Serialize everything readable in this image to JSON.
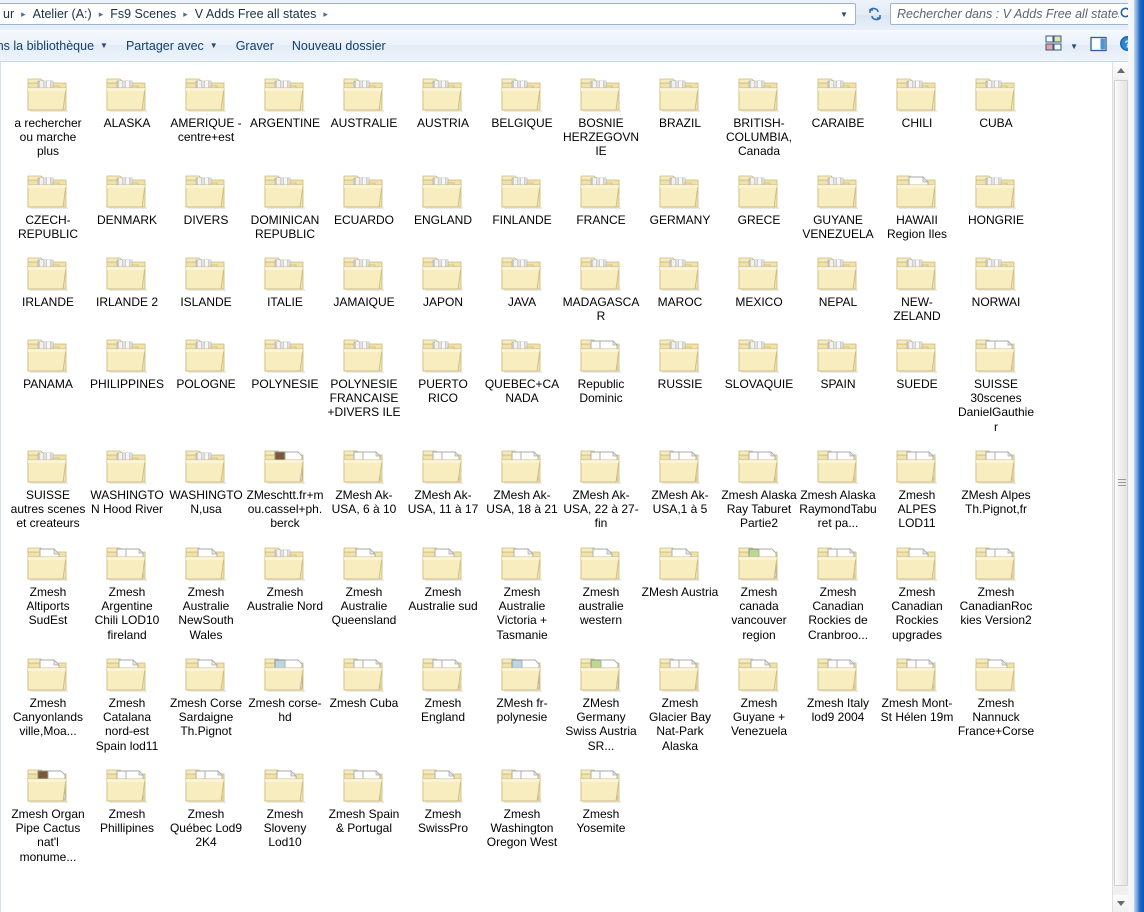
{
  "window": {
    "accent_color": "#1b69c6",
    "chrome_color": "#e3ebf6"
  },
  "addressbar": {
    "crumbs": [
      "ur",
      "Atelier (A:)",
      "Fs9 Scenes",
      "V Adds Free all states"
    ],
    "separator": "▸",
    "dropdown_icon": "chevron-down-icon",
    "refresh_icon": "refresh-icon",
    "search": {
      "placeholder": "Rechercher dans : V Adds Free all states",
      "value": "",
      "icon": "search-icon"
    }
  },
  "commandbar": {
    "items": [
      {
        "label": "lans la bibliothèque",
        "has_caret": true
      },
      {
        "label": "Partager avec",
        "has_caret": true
      },
      {
        "label": "Graver",
        "has_caret": false
      },
      {
        "label": "Nouveau dossier",
        "has_caret": false
      }
    ],
    "right_buttons": [
      {
        "name": "change-view-button",
        "icon": "view-icon"
      },
      {
        "name": "view-dropdown-button",
        "icon": "chevron-down-icon"
      },
      {
        "name": "preview-pane-button",
        "icon": "preview-pane-icon"
      },
      {
        "name": "help-button",
        "icon": "help-icon"
      }
    ]
  },
  "scrollbar": {
    "up_icon": "triangle-up-icon",
    "down_icon": "triangle-down-icon",
    "thumb_position_percent": 0
  },
  "files": {
    "columns": 13,
    "items": [
      {
        "name": "a rechercher ou marche plus",
        "icon": "folder-closed"
      },
      {
        "name": "ALASKA",
        "icon": "folder-closed"
      },
      {
        "name": "AMERIQUE -centre+est",
        "icon": "folder-closed"
      },
      {
        "name": "ARGENTINE",
        "icon": "folder-closed"
      },
      {
        "name": "AUSTRALIE",
        "icon": "folder-closed"
      },
      {
        "name": "AUSTRIA",
        "icon": "folder-closed"
      },
      {
        "name": "BELGIQUE",
        "icon": "folder-closed"
      },
      {
        "name": "BOSNIE HERZEGOVNIE",
        "icon": "folder-closed"
      },
      {
        "name": "BRAZIL",
        "icon": "folder-closed"
      },
      {
        "name": "BRITISH-COLUMBIA, Canada",
        "icon": "folder-closed"
      },
      {
        "name": "CARAIBE",
        "icon": "folder-closed"
      },
      {
        "name": "CHILI",
        "icon": "folder-closed"
      },
      {
        "name": "CUBA",
        "icon": "folder-closed"
      },
      {
        "name": "CZECH-REPUBLIC",
        "icon": "folder-closed"
      },
      {
        "name": "DENMARK",
        "icon": "folder-closed"
      },
      {
        "name": "DIVERS",
        "icon": "folder-closed"
      },
      {
        "name": "DOMINICAN REPUBLIC",
        "icon": "folder-closed"
      },
      {
        "name": "ECUARDO",
        "icon": "folder-closed"
      },
      {
        "name": "ENGLAND",
        "icon": "folder-closed"
      },
      {
        "name": "FINLANDE",
        "icon": "folder-closed"
      },
      {
        "name": "FRANCE",
        "icon": "folder-closed"
      },
      {
        "name": "GERMANY",
        "icon": "folder-closed"
      },
      {
        "name": "GRECE",
        "icon": "folder-closed"
      },
      {
        "name": "GUYANE VENEZUELA",
        "icon": "folder-closed"
      },
      {
        "name": "HAWAII Region Iles",
        "icon": "folder-one-doc"
      },
      {
        "name": "HONGRIE",
        "icon": "folder-closed"
      },
      {
        "name": "IRLANDE",
        "icon": "folder-closed"
      },
      {
        "name": "IRLANDE 2",
        "icon": "folder-closed"
      },
      {
        "name": "ISLANDE",
        "icon": "folder-closed"
      },
      {
        "name": "ITALIE",
        "icon": "folder-closed"
      },
      {
        "name": "JAMAIQUE",
        "icon": "folder-closed"
      },
      {
        "name": "JAPON",
        "icon": "folder-closed"
      },
      {
        "name": "JAVA",
        "icon": "folder-closed"
      },
      {
        "name": "MADAGASCAR",
        "icon": "folder-closed"
      },
      {
        "name": "MAROC",
        "icon": "folder-closed"
      },
      {
        "name": "MEXICO",
        "icon": "folder-closed"
      },
      {
        "name": "NEPAL",
        "icon": "folder-closed"
      },
      {
        "name": "NEW-ZELAND",
        "icon": "folder-closed"
      },
      {
        "name": "NORWAI",
        "icon": "folder-closed"
      },
      {
        "name": "PANAMA",
        "icon": "folder-closed"
      },
      {
        "name": "PHILIPPINES",
        "icon": "folder-closed"
      },
      {
        "name": "POLOGNE",
        "icon": "folder-closed"
      },
      {
        "name": "POLYNESIE",
        "icon": "folder-closed"
      },
      {
        "name": "POLYNESIE FRANCAISE +DIVERS ILE",
        "icon": "folder-closed"
      },
      {
        "name": "PUERTO RICO",
        "icon": "folder-closed"
      },
      {
        "name": "QUEBEC+CANADA",
        "icon": "folder-closed"
      },
      {
        "name": "Republic Dominic",
        "icon": "folder-two-docs"
      },
      {
        "name": "RUSSIE",
        "icon": "folder-closed"
      },
      {
        "name": "SLOVAQUIE",
        "icon": "folder-closed"
      },
      {
        "name": "SPAIN",
        "icon": "folder-closed"
      },
      {
        "name": "SUEDE",
        "icon": "folder-closed"
      },
      {
        "name": "SUISSE 30scenes DanielGauthier",
        "icon": "folder-two-docs"
      },
      {
        "name": "SUISSE autres scenes et createurs",
        "icon": "folder-closed"
      },
      {
        "name": "WASHINGTON Hood River",
        "icon": "folder-closed"
      },
      {
        "name": "WASHINGTON,usa",
        "icon": "folder-closed"
      },
      {
        "name": "ZMeschtt.fr+mou.cassel+ph.berck",
        "icon": "folder-thumb-dark"
      },
      {
        "name": "ZMesh Ak-USA, 6 à 10",
        "icon": "folder-two-docs"
      },
      {
        "name": "ZMesh Ak-USA, 11 à 17",
        "icon": "folder-two-docs"
      },
      {
        "name": "ZMesh Ak-USA, 18 à 21",
        "icon": "folder-two-docs"
      },
      {
        "name": "ZMesh Ak-USA, 22 à 27-fin",
        "icon": "folder-two-docs"
      },
      {
        "name": "ZMesh Ak-USA,1 à 5",
        "icon": "folder-two-docs"
      },
      {
        "name": "Zmesh Alaska Ray Taburet Partie2",
        "icon": "folder-two-docs"
      },
      {
        "name": "Zmesh Alaska RaymondTaburet pa...",
        "icon": "folder-two-docs"
      },
      {
        "name": "Zmesh ALPES LOD11",
        "icon": "folder-two-docs"
      },
      {
        "name": "ZMesh Alpes Th.Pignot,fr",
        "icon": "folder-two-docs"
      },
      {
        "name": "Zmesh Altiports SudEst",
        "icon": "folder-one-doc"
      },
      {
        "name": "Zmesh Argentine Chili LOD10 fireland",
        "icon": "folder-two-docs"
      },
      {
        "name": "Zmesh Australie NewSouth Wales",
        "icon": "folder-one-doc"
      },
      {
        "name": "Zmesh Australie Nord",
        "icon": "folder-closed"
      },
      {
        "name": "Zmesh Australie Queensland",
        "icon": "folder-one-doc"
      },
      {
        "name": "Zmesh Australie sud",
        "icon": "folder-one-doc"
      },
      {
        "name": "Zmesh Australie Victoria + Tasmanie",
        "icon": "folder-one-doc"
      },
      {
        "name": "Zmesh australie western",
        "icon": "folder-one-doc"
      },
      {
        "name": "ZMesh Austria",
        "icon": "folder-one-doc"
      },
      {
        "name": "Zmesh canada vancouver region",
        "icon": "folder-thumb-green"
      },
      {
        "name": "Zmesh Canadian Rockies de Cranbroo...",
        "icon": "folder-two-docs"
      },
      {
        "name": "Zmesh Canadian Rockies upgrades",
        "icon": "folder-one-doc"
      },
      {
        "name": "Zmesh CanadianRockies Version2",
        "icon": "folder-two-docs"
      },
      {
        "name": "Zmesh Canyonlands ville,Moa...",
        "icon": "folder-one-doc"
      },
      {
        "name": "Zmesh Catalana nord-est Spain lod11",
        "icon": "folder-one-doc"
      },
      {
        "name": "Zmesh Corse Sardaigne Th.Pignot",
        "icon": "folder-one-doc"
      },
      {
        "name": "Zmesh corse-hd",
        "icon": "folder-thumb-blue"
      },
      {
        "name": "Zmesh Cuba",
        "icon": "folder-two-docs"
      },
      {
        "name": "Zmesh England",
        "icon": "folder-two-docs"
      },
      {
        "name": "ZMesh fr-polynesie",
        "icon": "folder-thumb-blue"
      },
      {
        "name": "ZMesh Germany Swiss Austria SR...",
        "icon": "folder-thumb-green"
      },
      {
        "name": "Zmesh Glacier Bay Nat-Park Alaska",
        "icon": "folder-two-docs"
      },
      {
        "name": "Zmesh Guyane + Venezuela",
        "icon": "folder-one-doc"
      },
      {
        "name": "Zmesh Italy lod9 2004",
        "icon": "folder-two-docs"
      },
      {
        "name": "Zmesh Mont-St Hélen 19m",
        "icon": "folder-two-docs"
      },
      {
        "name": "Zmesh Nannuck France+Corse",
        "icon": "folder-one-doc"
      },
      {
        "name": "Zmesh Organ Pipe Cactus nat'l monume...",
        "icon": "folder-thumb-dark"
      },
      {
        "name": "Zmesh Phillipines",
        "icon": "folder-two-docs"
      },
      {
        "name": "Zmesh Québec Lod9 2K4",
        "icon": "folder-two-docs"
      },
      {
        "name": "Zmesh Sloveny Lod10",
        "icon": "folder-one-doc"
      },
      {
        "name": "Zmesh Spain & Portugal",
        "icon": "folder-two-docs"
      },
      {
        "name": "Zmesh SwissPro",
        "icon": "folder-one-doc"
      },
      {
        "name": "Zmesh Washington Oregon West",
        "icon": "folder-two-docs"
      },
      {
        "name": "Zmesh Yosemite",
        "icon": "folder-two-docs"
      }
    ]
  }
}
